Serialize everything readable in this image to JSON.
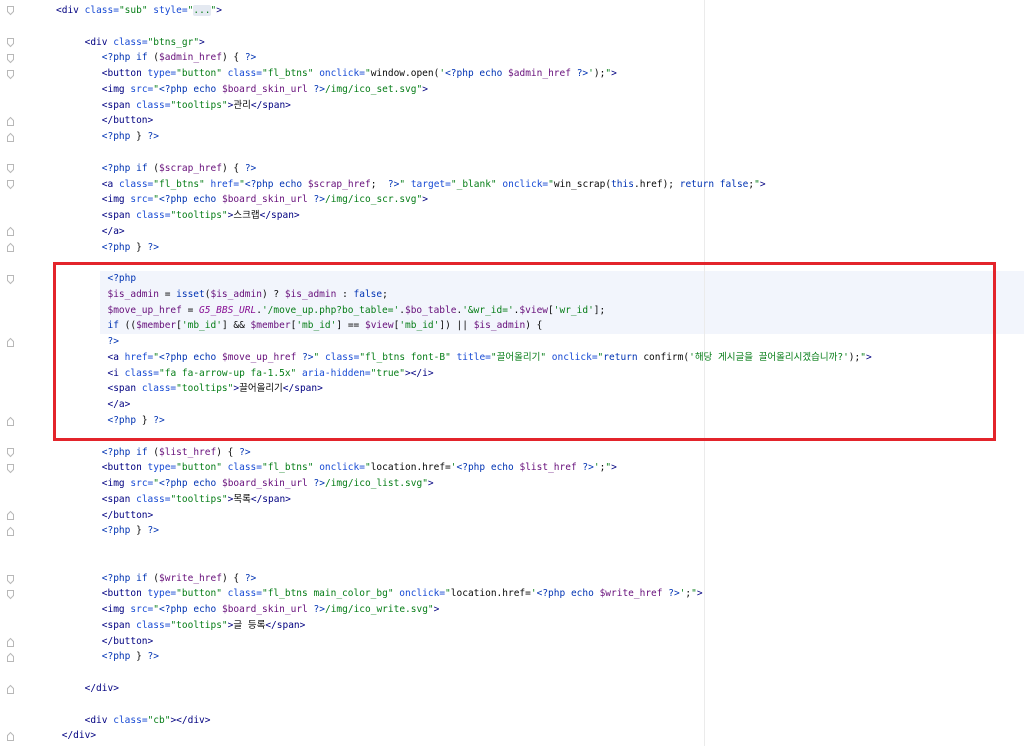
{
  "syntax_colors": {
    "tag": "#000080",
    "attr": "#174ad4",
    "str": "#067d17",
    "php": "#0033b3",
    "kw": "#0033b3",
    "var": "#660e7a",
    "const": "#871094",
    "txt": "#080808",
    "fold": "#067d17"
  },
  "annotation": {
    "color": "#e3242b"
  },
  "editor": {
    "fold_open_lines": [
      0,
      2,
      3,
      4,
      10,
      11,
      17,
      28,
      29,
      36,
      37
    ],
    "fold_close_lines": [
      7,
      8,
      14,
      15,
      21,
      26,
      32,
      33,
      40,
      41,
      43,
      46
    ],
    "php_block": {
      "first_line": 17,
      "last_line": 20
    },
    "lines": [
      [
        {
          "tag": "<div"
        },
        {
          "txt": " "
        },
        {
          "attr": "class="
        },
        {
          "str": "\"sub\""
        },
        {
          "txt": " "
        },
        {
          "attr": "style="
        },
        {
          "str": "\""
        },
        {
          "fold": "..."
        },
        {
          "str": "\""
        },
        {
          "tag": ">"
        }
      ],
      [],
      [
        {
          "txt": "     "
        },
        {
          "tag": "<div"
        },
        {
          "txt": " "
        },
        {
          "attr": "class="
        },
        {
          "str": "\"btns_gr\""
        },
        {
          "tag": ">"
        }
      ],
      [
        {
          "txt": "        "
        },
        {
          "php": "<?php"
        },
        {
          "txt": " "
        },
        {
          "kw": "if"
        },
        {
          "txt": " ("
        },
        {
          "var": "$admin_href"
        },
        {
          "txt": ") { "
        },
        {
          "php": "?>"
        }
      ],
      [
        {
          "txt": "        "
        },
        {
          "tag": "<button"
        },
        {
          "txt": " "
        },
        {
          "attr": "type="
        },
        {
          "str": "\"button\""
        },
        {
          "txt": " "
        },
        {
          "attr": "class="
        },
        {
          "str": "\"fl_btns\""
        },
        {
          "txt": " "
        },
        {
          "attr": "onclick="
        },
        {
          "str": "\""
        },
        {
          "txt": "window.open("
        },
        {
          "str": "'"
        },
        {
          "php": "<?php"
        },
        {
          "txt": " "
        },
        {
          "kw": "echo"
        },
        {
          "txt": " "
        },
        {
          "var": "$admin_href"
        },
        {
          "txt": " "
        },
        {
          "php": "?>"
        },
        {
          "str": "'"
        },
        {
          "txt": ");"
        },
        {
          "str": "\""
        },
        {
          "tag": ">"
        }
      ],
      [
        {
          "txt": "        "
        },
        {
          "tag": "<img"
        },
        {
          "txt": " "
        },
        {
          "attr": "src="
        },
        {
          "str": "\""
        },
        {
          "php": "<?php"
        },
        {
          "txt": " "
        },
        {
          "kw": "echo"
        },
        {
          "txt": " "
        },
        {
          "var": "$board_skin_url"
        },
        {
          "txt": " "
        },
        {
          "php": "?>"
        },
        {
          "str": "/img/ico_set.svg\""
        },
        {
          "tag": ">"
        }
      ],
      [
        {
          "txt": "        "
        },
        {
          "tag": "<span"
        },
        {
          "txt": " "
        },
        {
          "attr": "class="
        },
        {
          "str": "\"tooltips\""
        },
        {
          "tag": ">"
        },
        {
          "txt": "관리"
        },
        {
          "tag": "</span>"
        }
      ],
      [
        {
          "txt": "        "
        },
        {
          "tag": "</button>"
        }
      ],
      [
        {
          "txt": "        "
        },
        {
          "php": "<?php"
        },
        {
          "txt": " } "
        },
        {
          "php": "?>"
        }
      ],
      [],
      [
        {
          "txt": "        "
        },
        {
          "php": "<?php"
        },
        {
          "txt": " "
        },
        {
          "kw": "if"
        },
        {
          "txt": " ("
        },
        {
          "var": "$scrap_href"
        },
        {
          "txt": ") { "
        },
        {
          "php": "?>"
        }
      ],
      [
        {
          "txt": "        "
        },
        {
          "tag": "<a"
        },
        {
          "txt": " "
        },
        {
          "attr": "class="
        },
        {
          "str": "\"fl_btns\""
        },
        {
          "txt": " "
        },
        {
          "attr": "href="
        },
        {
          "str": "\""
        },
        {
          "php": "<?php"
        },
        {
          "txt": " "
        },
        {
          "kw": "echo"
        },
        {
          "txt": " "
        },
        {
          "var": "$scrap_href"
        },
        {
          "txt": ";  "
        },
        {
          "php": "?>"
        },
        {
          "str": "\""
        },
        {
          "txt": " "
        },
        {
          "attr": "target="
        },
        {
          "str": "\"_blank\""
        },
        {
          "txt": " "
        },
        {
          "attr": "onclick="
        },
        {
          "str": "\""
        },
        {
          "txt": "win_scrap("
        },
        {
          "kw": "this"
        },
        {
          "txt": ".href); "
        },
        {
          "kw": "return"
        },
        {
          "txt": " "
        },
        {
          "kw": "false"
        },
        {
          "txt": ";"
        },
        {
          "str": "\""
        },
        {
          "tag": ">"
        }
      ],
      [
        {
          "txt": "        "
        },
        {
          "tag": "<img"
        },
        {
          "txt": " "
        },
        {
          "attr": "src="
        },
        {
          "str": "\""
        },
        {
          "php": "<?php"
        },
        {
          "txt": " "
        },
        {
          "kw": "echo"
        },
        {
          "txt": " "
        },
        {
          "var": "$board_skin_url"
        },
        {
          "txt": " "
        },
        {
          "php": "?>"
        },
        {
          "str": "/img/ico_scr.svg\""
        },
        {
          "tag": ">"
        }
      ],
      [
        {
          "txt": "        "
        },
        {
          "tag": "<span"
        },
        {
          "txt": " "
        },
        {
          "attr": "class="
        },
        {
          "str": "\"tooltips\""
        },
        {
          "tag": ">"
        },
        {
          "txt": "스크랩"
        },
        {
          "tag": "</span>"
        }
      ],
      [
        {
          "txt": "        "
        },
        {
          "tag": "</a>"
        }
      ],
      [
        {
          "txt": "        "
        },
        {
          "php": "<?php"
        },
        {
          "txt": " } "
        },
        {
          "php": "?>"
        }
      ],
      [],
      [
        {
          "txt": "         "
        },
        {
          "php": "<?php"
        }
      ],
      [
        {
          "txt": "         "
        },
        {
          "var": "$is_admin"
        },
        {
          "txt": " = "
        },
        {
          "kw": "isset"
        },
        {
          "txt": "("
        },
        {
          "var": "$is_admin"
        },
        {
          "txt": ") ? "
        },
        {
          "var": "$is_admin"
        },
        {
          "txt": " : "
        },
        {
          "kw": "false"
        },
        {
          "txt": ";"
        }
      ],
      [
        {
          "txt": "         "
        },
        {
          "var": "$move_up_href"
        },
        {
          "txt": " = "
        },
        {
          "const": "G5_BBS_URL"
        },
        {
          "txt": "."
        },
        {
          "str": "'/move_up.php?bo_table='"
        },
        {
          "txt": "."
        },
        {
          "var": "$bo_table"
        },
        {
          "txt": "."
        },
        {
          "str": "'&wr_id='"
        },
        {
          "txt": "."
        },
        {
          "var": "$view"
        },
        {
          "txt": "["
        },
        {
          "str": "'wr_id'"
        },
        {
          "txt": "];"
        }
      ],
      [
        {
          "txt": "         "
        },
        {
          "kw": "if"
        },
        {
          "txt": " (("
        },
        {
          "var": "$member"
        },
        {
          "txt": "["
        },
        {
          "str": "'mb_id'"
        },
        {
          "txt": "] && "
        },
        {
          "var": "$member"
        },
        {
          "txt": "["
        },
        {
          "str": "'mb_id'"
        },
        {
          "txt": "] == "
        },
        {
          "var": "$view"
        },
        {
          "txt": "["
        },
        {
          "str": "'mb_id'"
        },
        {
          "txt": "]) || "
        },
        {
          "var": "$is_admin"
        },
        {
          "txt": ") {"
        }
      ],
      [
        {
          "txt": "         "
        },
        {
          "php": "?>"
        }
      ],
      [
        {
          "txt": "         "
        },
        {
          "tag": "<a"
        },
        {
          "txt": " "
        },
        {
          "attr": "href="
        },
        {
          "str": "\""
        },
        {
          "php": "<?php"
        },
        {
          "txt": " "
        },
        {
          "kw": "echo"
        },
        {
          "txt": " "
        },
        {
          "var": "$move_up_href"
        },
        {
          "txt": " "
        },
        {
          "php": "?>"
        },
        {
          "str": "\""
        },
        {
          "txt": " "
        },
        {
          "attr": "class="
        },
        {
          "str": "\"fl_btns font-B\""
        },
        {
          "txt": " "
        },
        {
          "attr": "title="
        },
        {
          "str": "\"끌어올리기\""
        },
        {
          "txt": " "
        },
        {
          "attr": "onclick="
        },
        {
          "str": "\""
        },
        {
          "kw": "return"
        },
        {
          "txt": " confirm("
        },
        {
          "str": "'해당 게시글을 끌어올리시겠습니까?'"
        },
        {
          "txt": ");"
        },
        {
          "str": "\""
        },
        {
          "tag": ">"
        }
      ],
      [
        {
          "txt": "         "
        },
        {
          "tag": "<i"
        },
        {
          "txt": " "
        },
        {
          "attr": "class="
        },
        {
          "str": "\"fa fa-arrow-up fa-1.5x\""
        },
        {
          "txt": " "
        },
        {
          "attr": "aria-hidden="
        },
        {
          "str": "\"true\""
        },
        {
          "tag": "></i>"
        }
      ],
      [
        {
          "txt": "         "
        },
        {
          "tag": "<span"
        },
        {
          "txt": " "
        },
        {
          "attr": "class="
        },
        {
          "str": "\"tooltips\""
        },
        {
          "tag": ">"
        },
        {
          "txt": "끌어올리기"
        },
        {
          "tag": "</span>"
        }
      ],
      [
        {
          "txt": "         "
        },
        {
          "tag": "</a>"
        }
      ],
      [
        {
          "txt": "         "
        },
        {
          "php": "<?php"
        },
        {
          "txt": " } "
        },
        {
          "php": "?>"
        }
      ],
      [],
      [
        {
          "txt": "        "
        },
        {
          "php": "<?php"
        },
        {
          "txt": " "
        },
        {
          "kw": "if"
        },
        {
          "txt": " ("
        },
        {
          "var": "$list_href"
        },
        {
          "txt": ") { "
        },
        {
          "php": "?>"
        }
      ],
      [
        {
          "txt": "        "
        },
        {
          "tag": "<button"
        },
        {
          "txt": " "
        },
        {
          "attr": "type="
        },
        {
          "str": "\"button\""
        },
        {
          "txt": " "
        },
        {
          "attr": "class="
        },
        {
          "str": "\"fl_btns\""
        },
        {
          "txt": " "
        },
        {
          "attr": "onclick="
        },
        {
          "str": "\""
        },
        {
          "txt": "location.href="
        },
        {
          "str": "'"
        },
        {
          "php": "<?php"
        },
        {
          "txt": " "
        },
        {
          "kw": "echo"
        },
        {
          "txt": " "
        },
        {
          "var": "$list_href"
        },
        {
          "txt": " "
        },
        {
          "php": "?>"
        },
        {
          "str": "'"
        },
        {
          "txt": ";"
        },
        {
          "str": "\""
        },
        {
          "tag": ">"
        }
      ],
      [
        {
          "txt": "        "
        },
        {
          "tag": "<img"
        },
        {
          "txt": " "
        },
        {
          "attr": "src="
        },
        {
          "str": "\""
        },
        {
          "php": "<?php"
        },
        {
          "txt": " "
        },
        {
          "kw": "echo"
        },
        {
          "txt": " "
        },
        {
          "var": "$board_skin_url"
        },
        {
          "txt": " "
        },
        {
          "php": "?>"
        },
        {
          "str": "/img/ico_list.svg\""
        },
        {
          "tag": ">"
        }
      ],
      [
        {
          "txt": "        "
        },
        {
          "tag": "<span"
        },
        {
          "txt": " "
        },
        {
          "attr": "class="
        },
        {
          "str": "\"tooltips\""
        },
        {
          "tag": ">"
        },
        {
          "txt": "목록"
        },
        {
          "tag": "</span>"
        }
      ],
      [
        {
          "txt": "        "
        },
        {
          "tag": "</button>"
        }
      ],
      [
        {
          "txt": "        "
        },
        {
          "php": "<?php"
        },
        {
          "txt": " } "
        },
        {
          "php": "?>"
        }
      ],
      [],
      [],
      [
        {
          "txt": "        "
        },
        {
          "php": "<?php"
        },
        {
          "txt": " "
        },
        {
          "kw": "if"
        },
        {
          "txt": " ("
        },
        {
          "var": "$write_href"
        },
        {
          "txt": ") { "
        },
        {
          "php": "?>"
        }
      ],
      [
        {
          "txt": "        "
        },
        {
          "tag": "<button"
        },
        {
          "txt": " "
        },
        {
          "attr": "type="
        },
        {
          "str": "\"button\""
        },
        {
          "txt": " "
        },
        {
          "attr": "class="
        },
        {
          "str": "\"fl_btns main_color_bg\""
        },
        {
          "txt": " "
        },
        {
          "attr": "onclick="
        },
        {
          "str": "\""
        },
        {
          "txt": "location.href="
        },
        {
          "str": "'"
        },
        {
          "php": "<?php"
        },
        {
          "txt": " "
        },
        {
          "kw": "echo"
        },
        {
          "txt": " "
        },
        {
          "var": "$write_href"
        },
        {
          "txt": " "
        },
        {
          "php": "?>"
        },
        {
          "str": "'"
        },
        {
          "txt": ";"
        },
        {
          "str": "\""
        },
        {
          "tag": ">"
        }
      ],
      [
        {
          "txt": "        "
        },
        {
          "tag": "<img"
        },
        {
          "txt": " "
        },
        {
          "attr": "src="
        },
        {
          "str": "\""
        },
        {
          "php": "<?php"
        },
        {
          "txt": " "
        },
        {
          "kw": "echo"
        },
        {
          "txt": " "
        },
        {
          "var": "$board_skin_url"
        },
        {
          "txt": " "
        },
        {
          "php": "?>"
        },
        {
          "str": "/img/ico_write.svg\""
        },
        {
          "tag": ">"
        }
      ],
      [
        {
          "txt": "        "
        },
        {
          "tag": "<span"
        },
        {
          "txt": " "
        },
        {
          "attr": "class="
        },
        {
          "str": "\"tooltips\""
        },
        {
          "tag": ">"
        },
        {
          "txt": "글 등록"
        },
        {
          "tag": "</span>"
        }
      ],
      [
        {
          "txt": "        "
        },
        {
          "tag": "</button>"
        }
      ],
      [
        {
          "txt": "        "
        },
        {
          "php": "<?php"
        },
        {
          "txt": " } "
        },
        {
          "php": "?>"
        }
      ],
      [],
      [
        {
          "txt": "     "
        },
        {
          "tag": "</div>"
        }
      ],
      [],
      [
        {
          "txt": "     "
        },
        {
          "tag": "<div"
        },
        {
          "txt": " "
        },
        {
          "attr": "class="
        },
        {
          "str": "\"cb\""
        },
        {
          "tag": "></div>"
        }
      ],
      [
        {
          "txt": " "
        },
        {
          "tag": "</div>"
        }
      ]
    ]
  }
}
